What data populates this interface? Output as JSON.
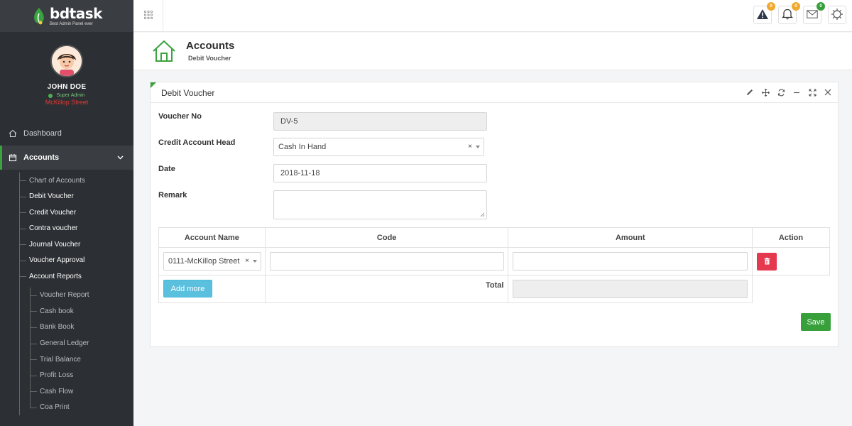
{
  "brand": {
    "name": "bdtask",
    "tagline": "Best Admin Panel ever",
    "accent": "#3aa23f"
  },
  "profile": {
    "name": "JOHN DOE",
    "role": "Super Admin",
    "location": "McKillop Street"
  },
  "sidebar": {
    "dashboard": "Dashboard",
    "accounts": "Accounts",
    "accounts_items": [
      "Chart of Accounts",
      "Debit Voucher",
      "Credit Voucher",
      "Contra voucher",
      "Journal Voucher",
      "Voucher Approval",
      "Account Reports"
    ],
    "report_items": [
      "Voucher Report",
      "Cash book",
      "Bank Book",
      "General Ledger",
      "Trial Balance",
      "Profit Loss",
      "Cash Flow",
      "Coa Print"
    ]
  },
  "topbar": {
    "badges": {
      "alert": "0",
      "notification": "0",
      "messages": "0"
    },
    "icons": [
      "apps-grid-icon",
      "warning-icon",
      "bell-icon",
      "envelope-icon",
      "settings-icon"
    ]
  },
  "page_header": {
    "title": "Accounts",
    "subtitle": "Debit Voucher"
  },
  "panel": {
    "title": "Debit Voucher"
  },
  "form": {
    "voucher_no_label": "Voucher No",
    "voucher_no_value": "DV-5",
    "credit_head_label": "Credit Account Head",
    "credit_head_value": "Cash In Hand",
    "date_label": "Date",
    "date_value": "2018-11-18",
    "remark_label": "Remark",
    "remark_value": ""
  },
  "table": {
    "headers": [
      "Account Name",
      "Code",
      "Amount",
      "Action"
    ],
    "rows": [
      {
        "account": "0111-McKillop Street",
        "code": "",
        "amount": ""
      }
    ],
    "add_more": "Add more",
    "total_label": "Total",
    "total_value": ""
  },
  "actions": {
    "save": "Save"
  }
}
